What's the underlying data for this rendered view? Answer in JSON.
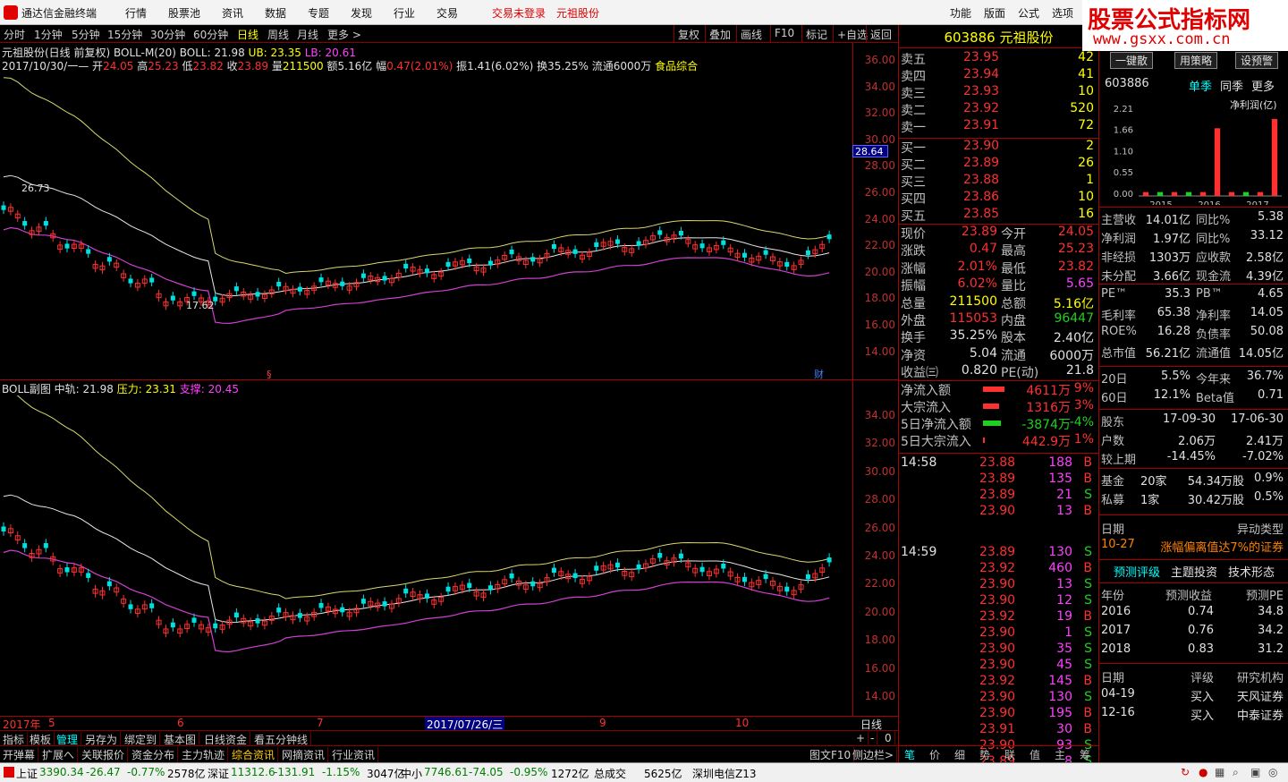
{
  "app": {
    "name": "通达信金融终端",
    "menu": [
      "行情",
      "股票池",
      "资讯",
      "数据",
      "专题",
      "发现",
      "行业",
      "交易"
    ],
    "login": "交易未登录",
    "stock_title": "元祖股份",
    "right_menu": [
      "功能",
      "版面",
      "公式",
      "选项"
    ]
  },
  "watermark": {
    "title": "股票公式指标网",
    "url": "www.gsxx.com.cn"
  },
  "periods": [
    "分时",
    "1分钟",
    "5分钟",
    "15分钟",
    "30分钟",
    "60分钟",
    "日线",
    "周线",
    "月线",
    "更多 >"
  ],
  "active_period": "日线",
  "toolbar_right": [
    "复权",
    "叠加",
    "画线",
    "F10",
    "标记",
    "+自选",
    "返回"
  ],
  "chart1": {
    "title": "元祖股份(日线 前复权) BOLL-M(20)",
    "boll": "BOLL: 21.98",
    "ub": "UB: 23.35",
    "lb": "LB: 20.61",
    "date": "2017/10/30/一",
    "open_l": "开",
    "open": "24.05",
    "high_l": "高",
    "high": "25.23",
    "low_l": "低",
    "low": "23.82",
    "close_l": "收",
    "close": "23.89",
    "vol_l": "量",
    "vol": "211500",
    "amt": "额5.16亿",
    "chg_l": "幅",
    "chg": "0.47(2.01%)",
    "amp": "振1.41(6.02%)",
    "turn": "换35.25%",
    "float": "流通6000万",
    "sector": "食品综合",
    "ticks": [
      "36.00",
      "34.00",
      "32.00",
      "30.00",
      "28.00",
      "26.00",
      "24.00",
      "22.00",
      "20.00",
      "18.00",
      "16.00",
      "14.00"
    ],
    "cursor": "28.64",
    "hi_label": "26.73",
    "lo_label": "17.62",
    "marks": [
      "§",
      "财"
    ]
  },
  "chart2": {
    "title": "BOLL副图",
    "mid": "中轨: 21.98",
    "press": "压力: 23.31",
    "support": "支撑: 20.45",
    "ticks": [
      "34.00",
      "32.00",
      "30.00",
      "28.00",
      "26.00",
      "24.00",
      "22.00",
      "20.00",
      "18.00",
      "16.00",
      "14.00"
    ]
  },
  "xaxis": {
    "labels": [
      "2017年",
      "5",
      "6",
      "7",
      "2017/07/26/三",
      "9",
      "10"
    ],
    "right": "日线"
  },
  "bottom_tabs1": [
    "指标",
    "模板",
    "管理",
    "另存为",
    "绑定到",
    "基本图",
    "日线资金",
    "看五分钟线"
  ],
  "bottom_tabs2": [
    "开弹幕",
    "扩展へ",
    "关联报价",
    "资金分布",
    "主力轨迹",
    "综合资讯",
    "网摘资讯",
    "行业资讯"
  ],
  "bottom_right": [
    "图文F10",
    "侧边栏>"
  ],
  "zoom": [
    "+",
    "-",
    "0"
  ],
  "quote": {
    "code": "603886",
    "name": "元祖股份",
    "asks": [
      [
        "卖五",
        "23.95",
        "42"
      ],
      [
        "卖四",
        "23.94",
        "41"
      ],
      [
        "卖三",
        "23.93",
        "10"
      ],
      [
        "卖二",
        "23.92",
        "520"
      ],
      [
        "卖一",
        "23.91",
        "72"
      ]
    ],
    "bids": [
      [
        "买一",
        "23.90",
        "2"
      ],
      [
        "买二",
        "23.89",
        "26"
      ],
      [
        "买三",
        "23.88",
        "1"
      ],
      [
        "买四",
        "23.86",
        "10"
      ],
      [
        "买五",
        "23.85",
        "16"
      ]
    ],
    "stats": [
      [
        "现价",
        "23.89",
        "今开",
        "24.05"
      ],
      [
        "涨跌",
        "0.47",
        "最高",
        "25.23"
      ],
      [
        "涨幅",
        "2.01%",
        "最低",
        "23.82"
      ],
      [
        "振幅",
        "6.02%",
        "量比",
        "5.65"
      ],
      [
        "总量",
        "211500",
        "总额",
        "5.16亿"
      ],
      [
        "外盘",
        "115053",
        "内盘",
        "96447"
      ],
      [
        "换手",
        "35.25%",
        "股本",
        "2.40亿"
      ],
      [
        "净资",
        "5.04",
        "流通",
        "6000万"
      ],
      [
        "收益㈢",
        "0.820",
        "PE(动)",
        "21.8"
      ]
    ],
    "flows": [
      [
        "净流入额",
        "4611万",
        "9%"
      ],
      [
        "大宗流入",
        "1316万",
        "3%"
      ],
      [
        "5日净流入额",
        "-3874万",
        "-4%"
      ],
      [
        "5日大宗流入",
        "442.9万",
        "1%"
      ]
    ],
    "ticks_time1": "14:58",
    "ticks_time2": "14:59",
    "trades1": [
      [
        "23.88",
        "188",
        "B"
      ],
      [
        "23.89",
        "135",
        "B"
      ],
      [
        "23.89",
        "21",
        "S"
      ],
      [
        "23.90",
        "13",
        "B"
      ]
    ],
    "trades2": [
      [
        "23.89",
        "130",
        "S"
      ],
      [
        "23.92",
        "460",
        "B"
      ],
      [
        "23.90",
        "13",
        "S"
      ],
      [
        "23.90",
        "12",
        "S"
      ],
      [
        "23.92",
        "19",
        "B"
      ],
      [
        "23.90",
        "1",
        "S"
      ],
      [
        "23.90",
        "35",
        "S"
      ],
      [
        "23.90",
        "45",
        "S"
      ],
      [
        "23.92",
        "145",
        "B"
      ],
      [
        "23.90",
        "130",
        "S"
      ],
      [
        "23.90",
        "195",
        "B"
      ],
      [
        "23.91",
        "30",
        "B"
      ],
      [
        "23.90",
        "93",
        "S"
      ],
      [
        "23.89",
        "8",
        "S"
      ]
    ],
    "tabs": [
      "笔",
      "价",
      "细",
      "势",
      "联",
      "值",
      "主",
      "筹"
    ]
  },
  "f10": {
    "buttons": [
      "一键散",
      "用策略",
      "设预警"
    ],
    "code": "603886",
    "tabs": [
      "单季",
      "同季",
      "更多"
    ],
    "chart_title": "净利润(亿)",
    "chart_data": {
      "type": "bar",
      "title": "净利润(亿)",
      "categories": [
        "2015",
        "2016",
        "2017"
      ],
      "yticks": [
        "2.21",
        "1.66",
        "1.10",
        "0.55",
        "0.00"
      ],
      "ylim": [
        0,
        2.21
      ],
      "series": [
        {
          "values": [
            0.1,
            0.1,
            0.1,
            0.1,
            0.1,
            1.76,
            0.1,
            0.1,
            0.1,
            2.0
          ],
          "colors": [
            "#ff3030",
            "#20d020"
          ]
        }
      ]
    },
    "fin": [
      [
        "主营收",
        "14.01亿",
        "同比%",
        "5.38"
      ],
      [
        "净利润",
        "1.97亿",
        "同比%",
        "33.12"
      ],
      [
        "非经损",
        "1303万",
        "应收款",
        "2.58亿"
      ],
      [
        "未分配",
        "3.66亿",
        "现金流",
        "4.39亿"
      ]
    ],
    "val": [
      [
        "PE™",
        "35.3",
        "PB™",
        "4.65"
      ],
      [
        "毛利率",
        "65.38",
        "净利率",
        "14.05"
      ],
      [
        "ROE%",
        "16.28",
        "负债率",
        "50.08"
      ],
      [
        "总市值",
        "56.21亿",
        "流通值",
        "14.05亿"
      ]
    ],
    "perf": [
      [
        "20日",
        "5.5%",
        "今年来",
        "36.7%"
      ],
      [
        "60日",
        "12.1%",
        "Beta值",
        "0.71"
      ]
    ],
    "holders": [
      [
        "股东",
        "17-09-30",
        "17-06-30"
      ],
      [
        "户数",
        "2.06万",
        "2.41万"
      ],
      [
        "较上期",
        "-14.45%",
        "-7.02%"
      ]
    ],
    "inst": [
      [
        "基金",
        "20家",
        "54.34万股",
        "0.9%"
      ],
      [
        "私募",
        "1家",
        "30.42万股",
        "0.5%"
      ]
    ],
    "event_hdr": [
      "日期",
      "异动类型"
    ],
    "event": [
      "10-27",
      "涨幅偏离值达7%的证券"
    ],
    "fc_tabs": [
      "预测评级",
      "主题投资",
      "技术形态"
    ],
    "fc_hdr": [
      "年份",
      "预测收益",
      "预测PE"
    ],
    "fc": [
      [
        "2016",
        "0.74",
        "34.8"
      ],
      [
        "2017",
        "0.76",
        "34.2"
      ],
      [
        "2018",
        "0.83",
        "31.2"
      ]
    ],
    "rt_hdr": [
      "日期",
      "评级",
      "研究机构"
    ],
    "rt": [
      [
        "04-19",
        "买入",
        "天风证券"
      ],
      [
        "12-16",
        "买入",
        "中泰证券"
      ]
    ]
  },
  "status": {
    "sh": "上证",
    "sh_v": "3390.34",
    "sh_c": "-26.47",
    "sh_p": "-0.77%",
    "sh_a": "2578亿",
    "sz": "深证",
    "sz_v": "11312.6",
    "sz_c": "-131.91",
    "sz_p": "-1.15%",
    "sz_a": "3047亿",
    "zx": "中小",
    "zx_v": "7746.61",
    "zx_c": "-74.05",
    "zx_p": "-0.95%",
    "zx_a": "1272亿",
    "tot": "总成交",
    "tot_v": "5625亿",
    "net": "深圳电信Z13"
  }
}
